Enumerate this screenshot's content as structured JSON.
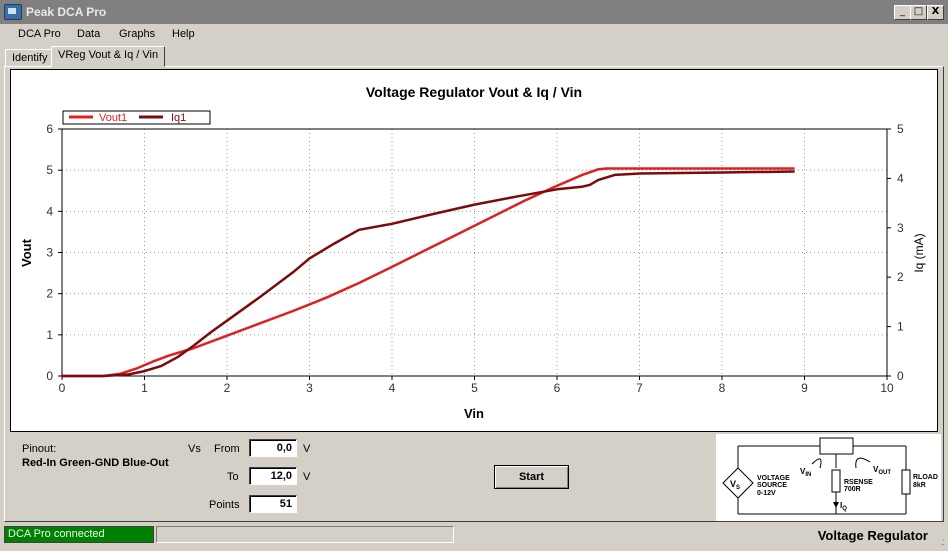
{
  "window": {
    "title": "Peak DCA Pro",
    "controls": [
      "_",
      "□",
      "X"
    ]
  },
  "menu": [
    "DCA Pro",
    "Data",
    "Graphs",
    "Help"
  ],
  "tabs": [
    {
      "label": "Identify",
      "active": false
    },
    {
      "label": "VReg Vout & Iq / Vin",
      "active": true
    }
  ],
  "chart_data": {
    "type": "line",
    "title": "Voltage Regulator Vout & Iq / Vin",
    "xlabel": "Vin",
    "ylabel": "Vout",
    "y2label": "Iq (mA)",
    "xlim": [
      0,
      10
    ],
    "ylim": [
      0,
      6
    ],
    "y2lim": [
      0,
      5
    ],
    "xticks": [
      "0",
      "1",
      "2",
      "3",
      "4",
      "5",
      "6",
      "7",
      "8",
      "9",
      "10"
    ],
    "yticks": [
      "0",
      "1",
      "2",
      "3",
      "4",
      "5",
      "6"
    ],
    "y2ticks": [
      "0",
      "1",
      "2",
      "3",
      "4",
      "5"
    ],
    "grid": true,
    "legend_position": "top-left",
    "series": [
      {
        "name": "Vout1",
        "axis": "left",
        "color": "#e02020",
        "x": [
          0,
          0.5,
          0.7,
          0.9,
          1.1,
          1.3,
          1.6,
          2.0,
          2.4,
          2.8,
          3.2,
          3.6,
          4.0,
          4.4,
          4.8,
          5.2,
          5.6,
          6.0,
          6.3,
          6.5,
          6.6,
          7.0,
          8.0,
          8.88
        ],
        "y": [
          0,
          0,
          0.05,
          0.18,
          0.35,
          0.5,
          0.68,
          0.98,
          1.28,
          1.58,
          1.9,
          2.26,
          2.65,
          3.05,
          3.45,
          3.85,
          4.25,
          4.62,
          4.88,
          5.02,
          5.04,
          5.04,
          5.04,
          5.04
        ]
      },
      {
        "name": "Iq1",
        "axis": "right",
        "color": "#7a0c0c",
        "x": [
          0,
          0.5,
          0.8,
          1.0,
          1.2,
          1.4,
          1.6,
          1.8,
          2.0,
          2.4,
          2.8,
          3.0,
          3.3,
          3.6,
          4.0,
          4.5,
          5.0,
          5.5,
          6.0,
          6.3,
          6.4,
          6.5,
          6.7,
          7.0,
          8.0,
          8.88
        ],
        "y": [
          0,
          0,
          0.03,
          0.1,
          0.2,
          0.38,
          0.62,
          0.88,
          1.12,
          1.6,
          2.1,
          2.38,
          2.68,
          2.96,
          3.08,
          3.28,
          3.47,
          3.63,
          3.78,
          3.83,
          3.87,
          3.97,
          4.07,
          4.1,
          4.12,
          4.14
        ]
      }
    ]
  },
  "controls": {
    "pinout_label": "Pinout:",
    "pinout_value": "Red-In Green-GND Blue-Out",
    "vs_label": "Vs",
    "from_label": "From",
    "from_value": "0,0",
    "from_unit": "V",
    "to_label": "To",
    "to_value": "12,0",
    "to_unit": "V",
    "points_label": "Points",
    "points_value": "51",
    "start_label": "Start"
  },
  "diagram": {
    "vs": "V",
    "vs_sub": "S",
    "source_line1": "VOLTAGE",
    "source_line2": "SOURCE",
    "source_line3": "0-12V",
    "vin": "V",
    "vin_sub": "IN",
    "vout": "V",
    "vout_sub": "OUT",
    "rsense_line1": "RSENSE",
    "rsense_line2": "700R",
    "iq": "I",
    "iq_sub": "Q",
    "rload_line1": "RLOAD",
    "rload_line2": "8kR"
  },
  "status": {
    "connection": "DCA Pro connected",
    "mode": "Voltage Regulator",
    "connection_color": "#008000"
  }
}
